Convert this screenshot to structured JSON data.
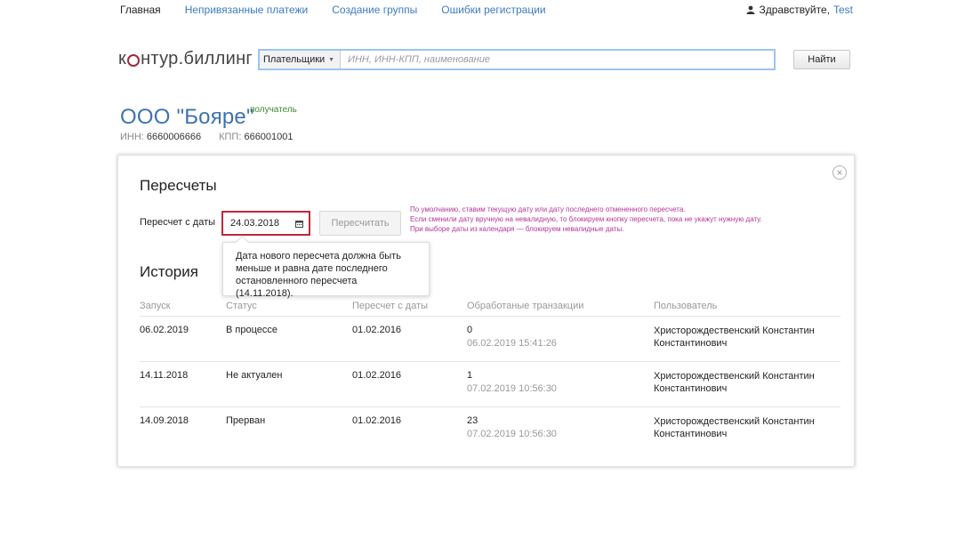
{
  "nav": {
    "home": "Главная",
    "links": [
      "Непривязанные платежи",
      "Создание группы",
      "Ошибки регистрации"
    ],
    "greeting": "Здравствуйте,",
    "user": "Test"
  },
  "logo": {
    "part1": "к",
    "part2": "нтур.биллинг"
  },
  "search": {
    "selector": "Плательщики",
    "placeholder": "ИНН, ИНН-КПП, наименование",
    "button": "Найти"
  },
  "company": {
    "name": "ООО \"Бояре\"",
    "role": "получатель",
    "inn_label": "ИНН:",
    "inn": "6660006666",
    "kpp_label": "КПП:",
    "kpp": "666001001"
  },
  "recalc": {
    "title": "Пересчеты",
    "date_label": "Пересчет с даты",
    "date_value": "24.03.2018",
    "button": "Пересчитать",
    "notes": [
      "По умолчанию, ставим текущую дату или дату последнего отмененного пересчета.",
      "Если сменили дату вручную на невалидную, то блокируем кнопку пересчета, пока не укажут нужную дату.",
      "При выборе даты из календаря — блокируем невалидные даты."
    ],
    "tooltip": "Дата нового пересчета должна быть меньше и равна дате последнего остановленного пересчета (14.11.2018)."
  },
  "history": {
    "title": "История",
    "columns": [
      "Запуск",
      "Статус",
      "Пересчет с даты",
      "Обработаные транзакции",
      "Пользователь"
    ],
    "rows": [
      {
        "start": "06.02.2019",
        "status": "В процессе",
        "from": "01.02.2016",
        "count": "0",
        "time": "06.02.2019 15:41:26",
        "user": "Христорождественский Константин Константинович"
      },
      {
        "start": "14.11.2018",
        "status": "Не актуален",
        "from": "01.02.2016",
        "count": "1",
        "time": "07.02.2019 10:56:30",
        "user": "Христорождественский Константин Константинович"
      },
      {
        "start": "14.09.2018",
        "status": "Прерван",
        "from": "01.02.2016",
        "count": "23",
        "time": "07.02.2019 10:56:30",
        "user": "Христорождественский Константин Константинович"
      }
    ]
  },
  "icons": {
    "user": "user-icon",
    "calendar": "calendar-icon",
    "close": "close-icon",
    "caret": "chevron-down-icon"
  },
  "colors": {
    "accent": "#3f72b0",
    "error": "#c0283a",
    "note": "#b5359a",
    "role": "#3b8a2e"
  }
}
